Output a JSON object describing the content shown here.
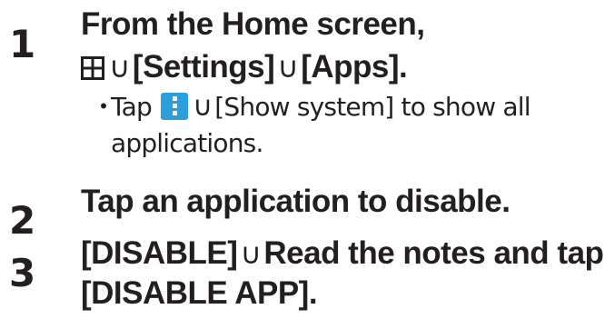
{
  "steps": [
    {
      "number": "1",
      "line1": "From the Home screen,",
      "line2_settings": "[Settings]",
      "line2_apps": "[Apps].",
      "note_bullet": "・",
      "note_tap": "Tap",
      "note_rest": "[Show system] to show all",
      "note_cont": "applications."
    },
    {
      "number": "2",
      "text": "Tap an application to disable."
    },
    {
      "number": "3",
      "line1_disable": "[DISABLE]",
      "line1_rest": "Read the notes and tap",
      "line2": "[DISABLE APP]."
    }
  ],
  "separator": "∪",
  "icons": {
    "apps": "apps-grid-icon",
    "menu": "more-vert-icon",
    "menu_color": "#2b9fd9",
    "text_color": "#231f20"
  }
}
